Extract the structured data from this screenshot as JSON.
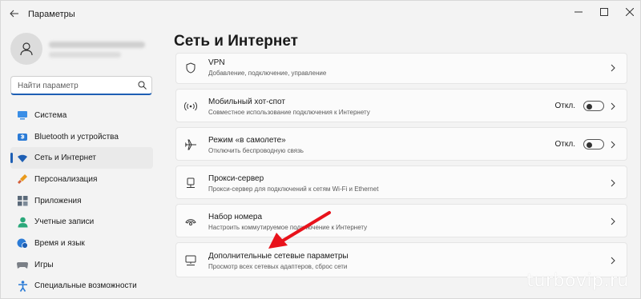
{
  "window": {
    "title": "Параметры"
  },
  "sidebar": {
    "search_placeholder": "Найти параметр",
    "items": [
      {
        "label": "Система",
        "icon": "monitor-icon",
        "active": false
      },
      {
        "label": "Bluetooth и устройства",
        "icon": "bluetooth-icon",
        "active": false
      },
      {
        "label": "Сеть и Интернет",
        "icon": "wifi-icon",
        "active": true
      },
      {
        "label": "Персонализация",
        "icon": "brush-icon",
        "active": false
      },
      {
        "label": "Приложения",
        "icon": "apps-icon",
        "active": false
      },
      {
        "label": "Учетные записи",
        "icon": "person-icon",
        "active": false
      },
      {
        "label": "Время и язык",
        "icon": "globe-clock-icon",
        "active": false
      },
      {
        "label": "Игры",
        "icon": "gamepad-icon",
        "active": false
      },
      {
        "label": "Специальные возможности",
        "icon": "accessibility-icon",
        "active": false
      }
    ]
  },
  "main": {
    "title": "Сеть и Интернет",
    "cards": [
      {
        "title": "VPN",
        "desc": "Добавление, подключение, управление",
        "icon": "shield-icon",
        "toggle": null
      },
      {
        "title": "Мобильный хот-спот",
        "desc": "Совместное использование подключения к Интернету",
        "icon": "hotspot-icon",
        "toggle": "Откл."
      },
      {
        "title": "Режим «в самолете»",
        "desc": "Отключить беспроводную связь",
        "icon": "airplane-icon",
        "toggle": "Откл."
      },
      {
        "title": "Прокси-сервер",
        "desc": "Прокси-сервер для подключений к сетям Wi-Fi и Ethernet",
        "icon": "proxy-icon",
        "toggle": null
      },
      {
        "title": "Набор номера",
        "desc": "Настроить коммутируемое подключение к Интернету",
        "icon": "dialup-icon",
        "toggle": null
      },
      {
        "title": "Дополнительные сетевые параметры",
        "desc": "Просмотр всех сетевых адаптеров, сброс сети",
        "icon": "network-pc-icon",
        "toggle": null
      }
    ]
  },
  "accent_color": "#1e5fb4",
  "annotation_arrow_color": "#e8121b",
  "watermark": "turbovip.ru"
}
